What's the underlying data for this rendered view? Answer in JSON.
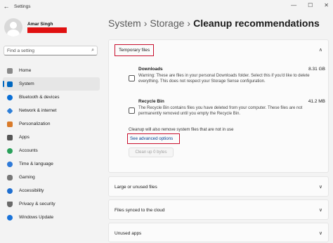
{
  "window": {
    "back_icon": "←",
    "title": "Settings",
    "controls": [
      "—",
      "☐",
      "✕"
    ]
  },
  "profile": {
    "name": "Amar Singh"
  },
  "search": {
    "placeholder": "Find a setting",
    "icon": "⌕"
  },
  "nav": [
    {
      "label": "Home",
      "icon": "home-icon",
      "color": "#8a8a8a",
      "active": false
    },
    {
      "label": "System",
      "icon": "system-icon",
      "color": "#0067c0",
      "active": true
    },
    {
      "label": "Bluetooth & devices",
      "icon": "bluetooth-icon",
      "color": "#0a6fd6",
      "active": false
    },
    {
      "label": "Network & internet",
      "icon": "network-icon",
      "color": "#2f80d8",
      "active": false
    },
    {
      "label": "Personalization",
      "icon": "brush-icon",
      "color": "#d97b2a",
      "active": false
    },
    {
      "label": "Apps",
      "icon": "apps-icon",
      "color": "#555555",
      "active": false
    },
    {
      "label": "Accounts",
      "icon": "accounts-icon",
      "color": "#2aa05a",
      "active": false
    },
    {
      "label": "Time & language",
      "icon": "time-icon",
      "color": "#2f7ad8",
      "active": false
    },
    {
      "label": "Gaming",
      "icon": "gaming-icon",
      "color": "#777777",
      "active": false
    },
    {
      "label": "Accessibility",
      "icon": "accessibility-icon",
      "color": "#1f6fd0",
      "active": false
    },
    {
      "label": "Privacy & security",
      "icon": "shield-icon",
      "color": "#6a6a6a",
      "active": false
    },
    {
      "label": "Windows Update",
      "icon": "update-icon",
      "color": "#1a73d9",
      "active": false
    }
  ],
  "breadcrumb": {
    "part1": "System",
    "part2": "Storage",
    "current": "Cleanup recommendations",
    "sep": "›"
  },
  "temp_files": {
    "label": "Temporary files",
    "chevron": "∧",
    "items": [
      {
        "title": "Downloads",
        "size": "8.31 GB",
        "desc": "Warning: These are files in your personal Downloads folder. Select this if you'd like to delete everything. This does not respect your Storage Sense configuration."
      },
      {
        "title": "Recycle Bin",
        "size": "41.2 MB",
        "desc": "The Recycle Bin contains files you have deleted from your computer. These files are not permanently removed until you empty the Recycle Bin."
      }
    ],
    "note": "Cleanup will also remove system files that are not in use",
    "advanced_link": "See advanced options",
    "cleanup_button": "Clean up 0 bytes"
  },
  "sections": [
    {
      "label": "Large or unused files",
      "chevron": "∨"
    },
    {
      "label": "Files synced to the cloud",
      "chevron": "∨"
    },
    {
      "label": "Unused apps",
      "chevron": "∨"
    }
  ]
}
